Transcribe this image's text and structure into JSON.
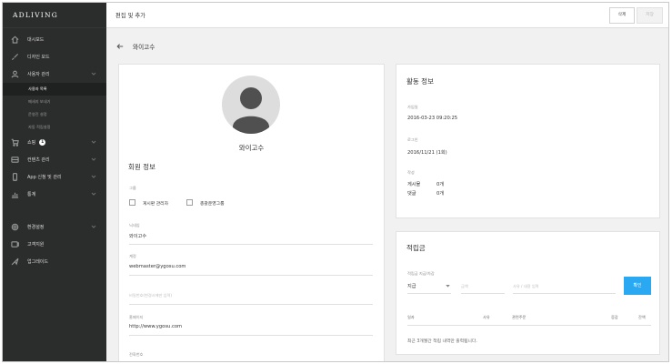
{
  "sidebar": {
    "logo": "ADLIVING",
    "items": [
      {
        "label": "대시보드",
        "icon": "home-icon"
      },
      {
        "label": "디자인 모드",
        "icon": "brush-icon"
      },
      {
        "label": "사용자 관리",
        "icon": "user-icon"
      },
      {
        "label": "쇼핑",
        "icon": "cart-icon",
        "badge": "1"
      },
      {
        "label": "컨텐츠 관리",
        "icon": "content-icon"
      },
      {
        "label": "App 신청 및 관리",
        "icon": "mobile-icon"
      },
      {
        "label": "통계",
        "icon": "chart-icon"
      },
      {
        "label": "환경설정",
        "icon": "gear-icon"
      },
      {
        "label": "고객지원",
        "icon": "support-icon"
      },
      {
        "label": "업그레이드",
        "icon": "upgrade-icon"
      }
    ],
    "sub_items": [
      {
        "label": "사용자 목록",
        "active": true
      },
      {
        "label": "메세지 보내기",
        "active": false
      },
      {
        "label": "운영진 설정",
        "active": false
      },
      {
        "label": "자동 적립설정",
        "active": false
      }
    ]
  },
  "topbar": {
    "title": "편집 및 추가",
    "delete_label": "삭제",
    "save_label": "저장"
  },
  "page": {
    "title": "와이고수"
  },
  "profile": {
    "name": "와이고수",
    "section_title": "회원 정보",
    "group_label": "그룹",
    "group_options": [
      "게시판 관리자",
      "총괄운영그룹"
    ],
    "nickname_label": "닉네임",
    "nickname": "와이고수",
    "account_label": "계정",
    "account": "webmaster@ygosu.com",
    "password_placeholder": "비밀번호(변경시에만 입력)",
    "homepage_label": "홈페이지",
    "homepage": "http://www.ygosu.com",
    "phone_label": "전화번호"
  },
  "activity": {
    "title": "활동 정보",
    "joined_label": "가입일",
    "joined": "2016-03-23 09:20:25",
    "login_label": "로그인",
    "login": "2016/11/21 (1회)",
    "writing_label": "작성",
    "posts_label": "게시물",
    "posts": "0개",
    "comments_label": "댓글",
    "comments": "0개"
  },
  "points": {
    "title": "적립금",
    "form_label": "적립금 지급/차감",
    "type_value": "지급",
    "amount_placeholder": "금액",
    "reason_placeholder": "사유 / 내용 입력",
    "confirm_label": "확인",
    "columns": [
      "일자",
      "사유",
      "관련주문",
      "증감",
      "잔액"
    ],
    "empty_message": "최근 3개월간 적립 내역만 출력됩니다."
  },
  "colors": {
    "sidebar": "#2b2c2c",
    "accent": "#2aa8f2",
    "background": "#f1f1f1"
  }
}
